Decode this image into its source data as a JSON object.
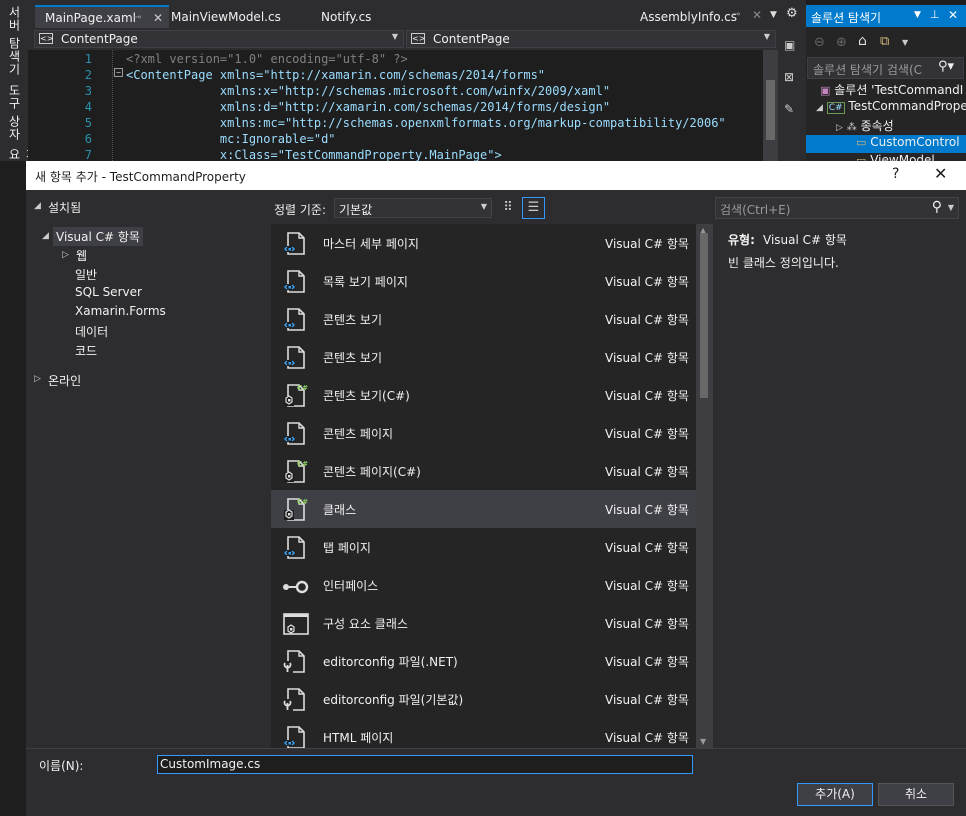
{
  "side_tabs": [
    "서버 탐색기",
    "도구 상자",
    "문서 개요"
  ],
  "editor_tabs": [
    {
      "label": "MainPage.xaml",
      "active": true
    },
    {
      "label": "MainViewModel.cs"
    },
    {
      "label": "Notify.cs"
    },
    {
      "label": "AssemblyInfo.cs"
    }
  ],
  "nav": {
    "left": "ContentPage",
    "right": "ContentPage"
  },
  "code_lines": [
    {
      "num": "1",
      "text": "<?xml version=\"1.0\" encoding=\"utf-8\" ?>"
    },
    {
      "num": "2",
      "text": "<ContentPage xmlns=\"http://xamarin.com/schemas/2014/forms\""
    },
    {
      "num": "3",
      "text": "             xmlns:x=\"http://schemas.microsoft.com/winfx/2009/xaml\""
    },
    {
      "num": "4",
      "text": "             xmlns:d=\"http://xamarin.com/schemas/2014/forms/design\""
    },
    {
      "num": "5",
      "text": "             xmlns:mc=\"http://schemas.openxmlformats.org/markup-compatibility/2006\""
    },
    {
      "num": "6",
      "text": "             mc:Ignorable=\"d\""
    },
    {
      "num": "7",
      "text": "             x:Class=\"TestCommandProperty.MainPage\">"
    }
  ],
  "solution_explorer": {
    "title": "솔루션 탐색기",
    "search_placeholder": "솔루션 탐색기 검색(C",
    "tree": [
      {
        "label": "솔루션 'TestCommandI"
      },
      {
        "label": "TestCommandPrope"
      },
      {
        "label": "종속성"
      },
      {
        "label": "CustomControl",
        "selected": true
      },
      {
        "label": "ViewModel"
      }
    ]
  },
  "dialog": {
    "title": "새 항목 추가 - TestCommandProperty",
    "help": "?",
    "close": "✕",
    "installed": "설치됨",
    "categories": {
      "root": "Visual C# 항목",
      "children": [
        "웹",
        "일반",
        "SQL Server",
        "Xamarin.Forms",
        "데이터",
        "코드"
      ]
    },
    "online": "온라인",
    "sort_label": "정렬 기준:",
    "sort_value": "기본값",
    "search_placeholder": "검색(Ctrl+E)",
    "templates": [
      {
        "name": "마스터 세부 페이지",
        "type": "Visual C# 항목",
        "icon": "xaml-page-icon"
      },
      {
        "name": "목록 보기 페이지",
        "type": "Visual C# 항목",
        "icon": "xaml-page-icon"
      },
      {
        "name": "콘텐츠 보기",
        "type": "Visual C# 항목",
        "icon": "xaml-page-icon"
      },
      {
        "name": "콘텐츠 보기",
        "type": "Visual C# 항목",
        "icon": "xaml-page-icon"
      },
      {
        "name": "콘텐츠 보기(C#)",
        "type": "Visual C# 항목",
        "icon": "csharp-class-icon"
      },
      {
        "name": "콘텐츠 페이지",
        "type": "Visual C# 항목",
        "icon": "xaml-page-icon"
      },
      {
        "name": "콘텐츠 페이지(C#)",
        "type": "Visual C# 항목",
        "icon": "csharp-class-icon"
      },
      {
        "name": "클래스",
        "type": "Visual C# 항목",
        "icon": "csharp-class-icon",
        "selected": true
      },
      {
        "name": "탭 페이지",
        "type": "Visual C# 항목",
        "icon": "xaml-page-icon"
      },
      {
        "name": "인터페이스",
        "type": "Visual C# 항목",
        "icon": "interface-icon"
      },
      {
        "name": "구성 요소 클래스",
        "type": "Visual C# 항목",
        "icon": "component-class-icon"
      },
      {
        "name": "editorconfig 파일(.NET)",
        "type": "Visual C# 항목",
        "icon": "editorconfig-icon"
      },
      {
        "name": "editorconfig 파일(기본값)",
        "type": "Visual C# 항목",
        "icon": "editorconfig-icon"
      },
      {
        "name": "HTML 페이지",
        "type": "Visual C# 항목",
        "icon": "xaml-page-icon"
      }
    ],
    "details": {
      "type_label": "유형:",
      "type_value": "Visual C# 항목",
      "description": "빈 클래스 정의입니다."
    },
    "name_label": "이름(N):",
    "name_value": "CustomImage.cs",
    "add_button": "추가(A)",
    "cancel_button": "취소"
  }
}
